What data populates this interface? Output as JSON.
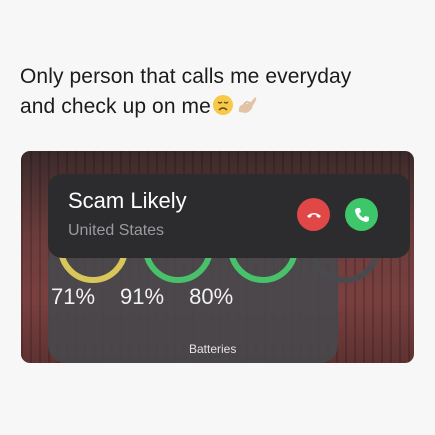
{
  "caption": {
    "line1": "Only person that calls me everyday",
    "line2": "and check up on me"
  },
  "icons": {
    "caption": [
      "disappointed-face-emoji",
      "pinching-hand-emoji"
    ],
    "call": [
      "phone-decline-icon",
      "phone-accept-icon"
    ]
  },
  "call_banner": {
    "caller_name": "Scam Likely",
    "location": "United States"
  },
  "batteries_widget": {
    "title": "Batteries",
    "levels": [
      "71%",
      "91%",
      "80%"
    ],
    "ring_colors": [
      "#d9c65a",
      "#49c16a",
      "#49c16a",
      "#4a4a4e"
    ]
  },
  "colors": {
    "decline": "#e04848",
    "accept": "#3ec66a"
  }
}
